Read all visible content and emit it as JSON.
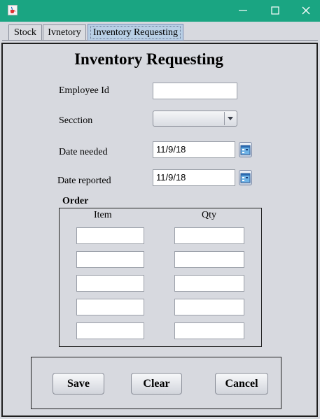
{
  "tabs": [
    "Stock",
    "Ivnetory",
    "Inventory Requesting"
  ],
  "active_tab": "Inventory Requesting",
  "form": {
    "title": "Inventory Requesting",
    "employee_id": {
      "label": "Employee Id",
      "value": ""
    },
    "section": {
      "label": "Secction",
      "value": ""
    },
    "date_needed": {
      "label": "Date needed",
      "value": "11/9/18"
    },
    "date_reported": {
      "label": "Date reported",
      "value": "11/9/18"
    }
  },
  "order": {
    "title": "Order",
    "columns": [
      "Item",
      "Qty"
    ],
    "rows": [
      {
        "item": "",
        "qty": ""
      },
      {
        "item": "",
        "qty": ""
      },
      {
        "item": "",
        "qty": ""
      },
      {
        "item": "",
        "qty": ""
      },
      {
        "item": "",
        "qty": ""
      }
    ]
  },
  "buttons": {
    "save": "Save",
    "clear": "Clear",
    "cancel": "Cancel"
  },
  "icons": {
    "app": "java-cup-icon",
    "minimize": "minimize-icon",
    "maximize": "maximize-icon",
    "close": "close-icon",
    "dropdown": "chevron-down-icon",
    "calendar": "calendar-icon"
  },
  "colors": {
    "titlebar": "#1aa582",
    "background": "#d7d9df",
    "active_tab": "#b8cfe5"
  }
}
